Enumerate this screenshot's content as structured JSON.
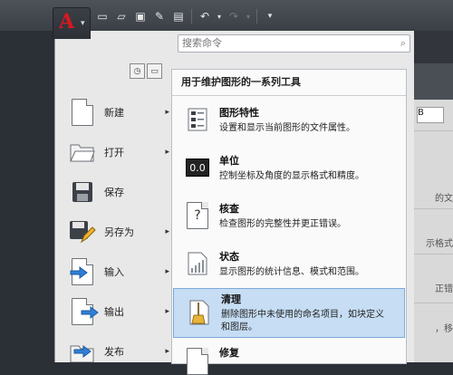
{
  "search": {
    "placeholder": "搜索命令"
  },
  "left_menu": [
    {
      "label": "新建",
      "icon": "new-document-icon",
      "has_submenu": true
    },
    {
      "label": "打开",
      "icon": "open-folder-icon",
      "has_submenu": true
    },
    {
      "label": "保存",
      "icon": "floppy-disk-icon",
      "has_submenu": false
    },
    {
      "label": "另存为",
      "icon": "save-as-icon",
      "has_submenu": true
    },
    {
      "label": "输入",
      "icon": "import-icon",
      "has_submenu": true
    },
    {
      "label": "输出",
      "icon": "export-icon",
      "has_submenu": true
    },
    {
      "label": "发布",
      "icon": "publish-icon",
      "has_submenu": true
    }
  ],
  "right_panel": {
    "header": "用于维护图形的一系列工具",
    "items": [
      {
        "title": "图形特性",
        "desc": "设置和显示当前图形的文件属性。",
        "icon": "drawing-properties-icon",
        "selected": false
      },
      {
        "title": "单位",
        "desc": "控制坐标及角度的显示格式和精度。",
        "icon": "units-icon",
        "icon_text": "0.0",
        "selected": false
      },
      {
        "title": "核查",
        "desc": "检查图形的完整性并更正错误。",
        "icon": "audit-icon",
        "icon_text": "?",
        "selected": false
      },
      {
        "title": "状态",
        "desc": "显示图形的统计信息、模式和范围。",
        "icon": "status-chart-icon",
        "selected": false
      },
      {
        "title": "清理",
        "desc": "删除图形中未使用的命名项目，如块定义",
        "desc2": "和图层。",
        "icon": "purge-broom-icon",
        "selected": true
      },
      {
        "title": "修复",
        "desc": "",
        "icon": "recover-icon",
        "selected": false
      }
    ]
  },
  "background_right": {
    "line1": "的文",
    "line2": "示格式",
    "line3": "正错",
    "line4": "，移",
    "box_text": "B"
  },
  "colors": {
    "selected_bg": "#c6ddf4",
    "logo_red": "#d71920"
  }
}
